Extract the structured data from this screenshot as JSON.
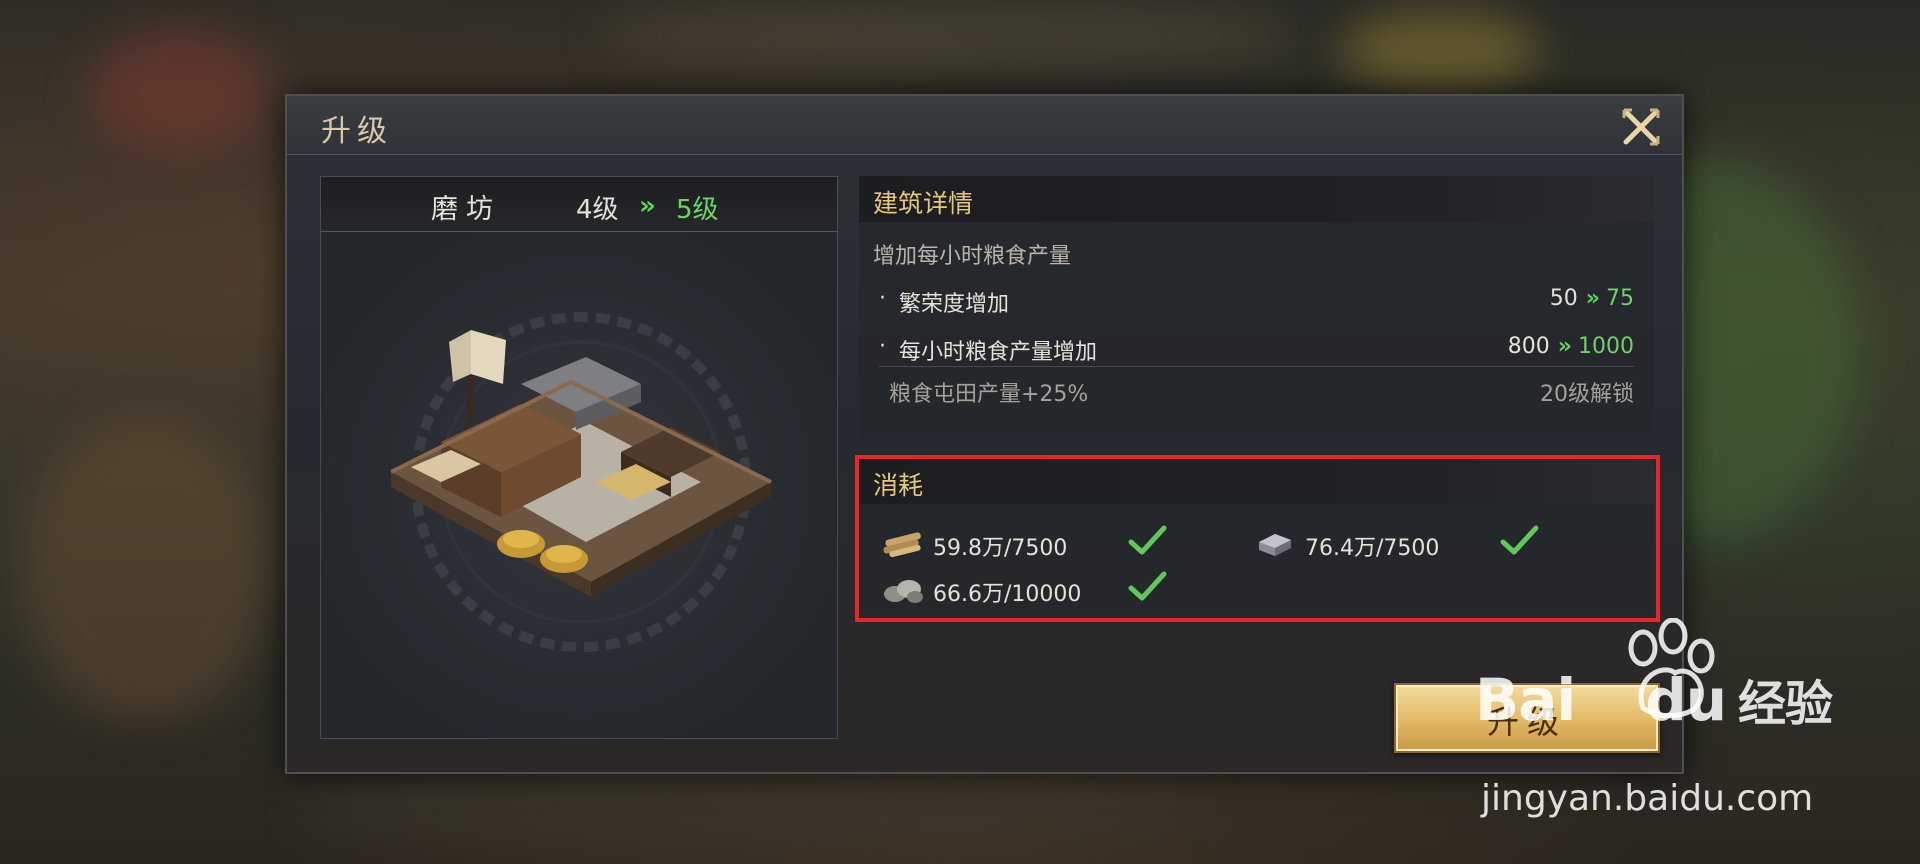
{
  "dialog": {
    "title": "升级"
  },
  "building": {
    "name": "磨坊",
    "level_from": "4级",
    "level_arrow": "»",
    "level_to": "5级"
  },
  "details": {
    "header": "建筑详情",
    "description": "增加每小时粮食产量",
    "rows": [
      {
        "label": "繁荣度增加",
        "from": "50",
        "to": "75"
      },
      {
        "label": "每小时粮食产量增加",
        "from": "800",
        "to": "1000"
      }
    ],
    "unlock": {
      "label": "粮食屯田产量+25%",
      "requirement": "20级解锁"
    }
  },
  "consume": {
    "header": "消耗",
    "resources": [
      {
        "icon": "wood-icon",
        "amount": "59.8万/7500",
        "met": true
      },
      {
        "icon": "iron-icon",
        "amount": "76.4万/7500",
        "met": true
      },
      {
        "icon": "stone-icon",
        "amount": "66.6万/10000",
        "met": true
      }
    ]
  },
  "upgrade_button": {
    "label": "升级"
  },
  "watermark": {
    "brand": "Bai",
    "brand_suffix": "du",
    "brand_cn": "经验",
    "url": "jingyan.baidu.com"
  },
  "colors": {
    "accent_green": "#6cd466",
    "title_gold": "#e8c87a",
    "highlight_red": "#e8262a",
    "button_gold": "#e2b865"
  }
}
